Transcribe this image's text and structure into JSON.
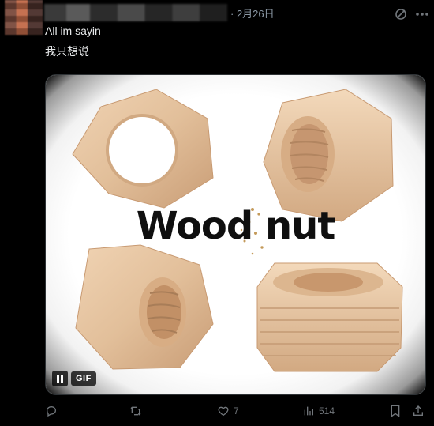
{
  "post": {
    "date": "· 2月26日",
    "text_line_1": "All im sayin",
    "text_line_2": "我只想说"
  },
  "media": {
    "overlay_text": "Wood nut",
    "gif_label": "GIF"
  },
  "actions": {
    "replies": "",
    "reposts": "",
    "likes": "7",
    "views": "514"
  },
  "icons": {
    "grok": "grok-icon",
    "more": "more-icon",
    "reply": "reply-icon",
    "repost": "repost-icon",
    "like": "heart-icon",
    "views": "views-icon",
    "bookmark": "bookmark-icon",
    "share": "share-icon",
    "pause": "pause-icon"
  },
  "colors": {
    "background": "#000000",
    "text": "#e7e9ea",
    "muted": "#71767b",
    "date": "#8b98a5",
    "wood_light": "#e8c9a8",
    "wood_dark": "#c79a74"
  }
}
